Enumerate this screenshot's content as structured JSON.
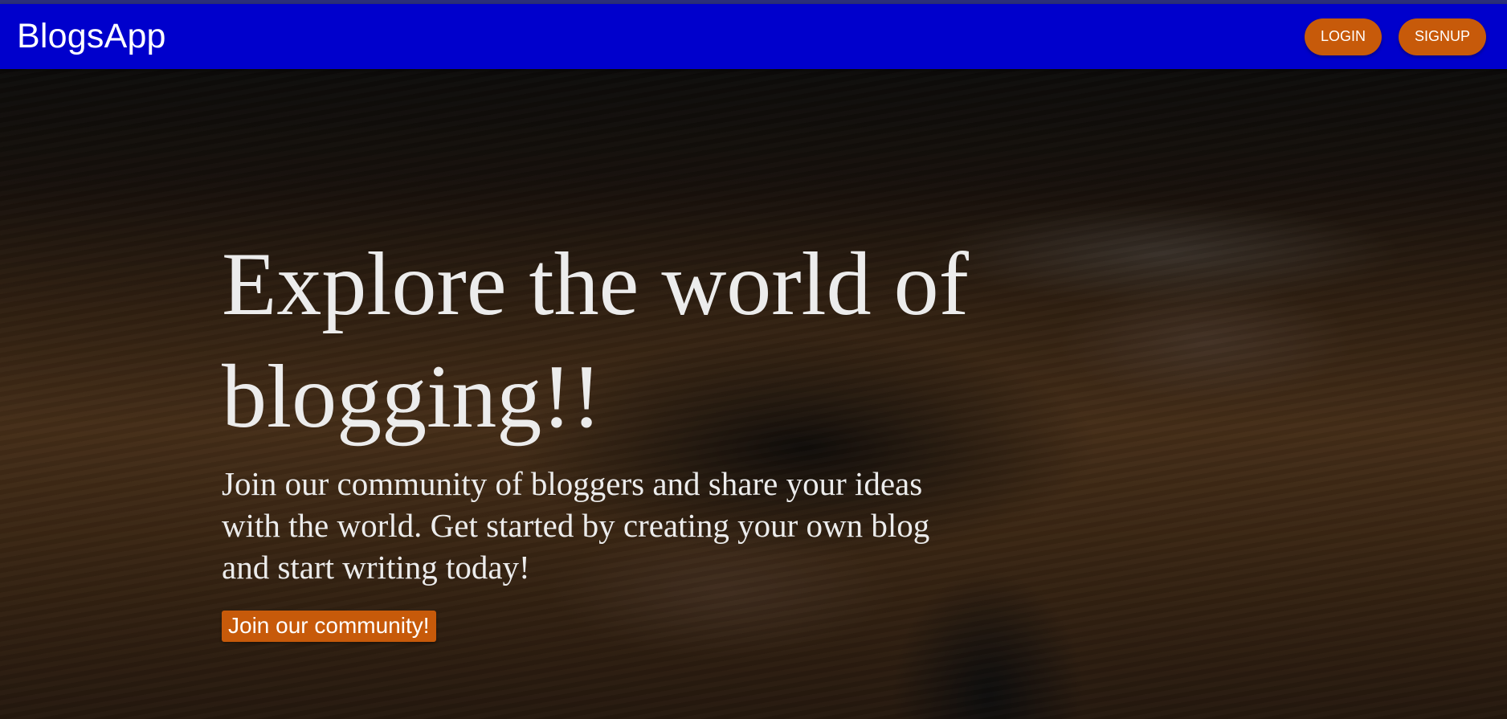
{
  "navbar": {
    "brand": "BlogsApp",
    "login_label": "LOGIN",
    "signup_label": "SIGNUP"
  },
  "hero": {
    "title": "Explore the world of blogging!!",
    "subtitle": "Join our community of bloggers and share your ideas with the world. Get started by creating your own blog and start writing today!",
    "cta_label": "Join our community!",
    "background_image": "person-typing-on-keyboard-at-desk"
  },
  "colors": {
    "navbar_bg": "#0000cc",
    "button_bg": "#c75a0a",
    "hero_text": "#ececec"
  }
}
